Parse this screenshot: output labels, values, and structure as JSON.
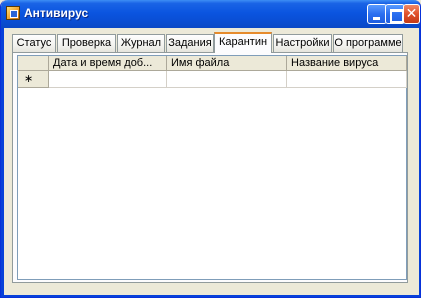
{
  "window": {
    "title": "Антивирус",
    "icons": {
      "app": "app-icon",
      "minimize": "minimize-icon",
      "maximize": "maximize-icon",
      "close": "close-icon"
    },
    "close_glyph": "✕"
  },
  "tabs": [
    {
      "label": "Статус"
    },
    {
      "label": "Проверка"
    },
    {
      "label": "Журнал"
    },
    {
      "label": "Задания"
    },
    {
      "label": "Карантин",
      "active": true
    },
    {
      "label": "Настройки"
    },
    {
      "label": "О программе"
    }
  ],
  "grid": {
    "columns": [
      "Дата и время доб...",
      "Имя файла",
      "Название вируса"
    ],
    "new_row_marker": "∗",
    "rows": []
  },
  "colors": {
    "titlebar": "#0a55e0",
    "active_tab_accent": "#e68b2c",
    "frame": "#0841d9",
    "window_bg": "#ece9d8"
  }
}
